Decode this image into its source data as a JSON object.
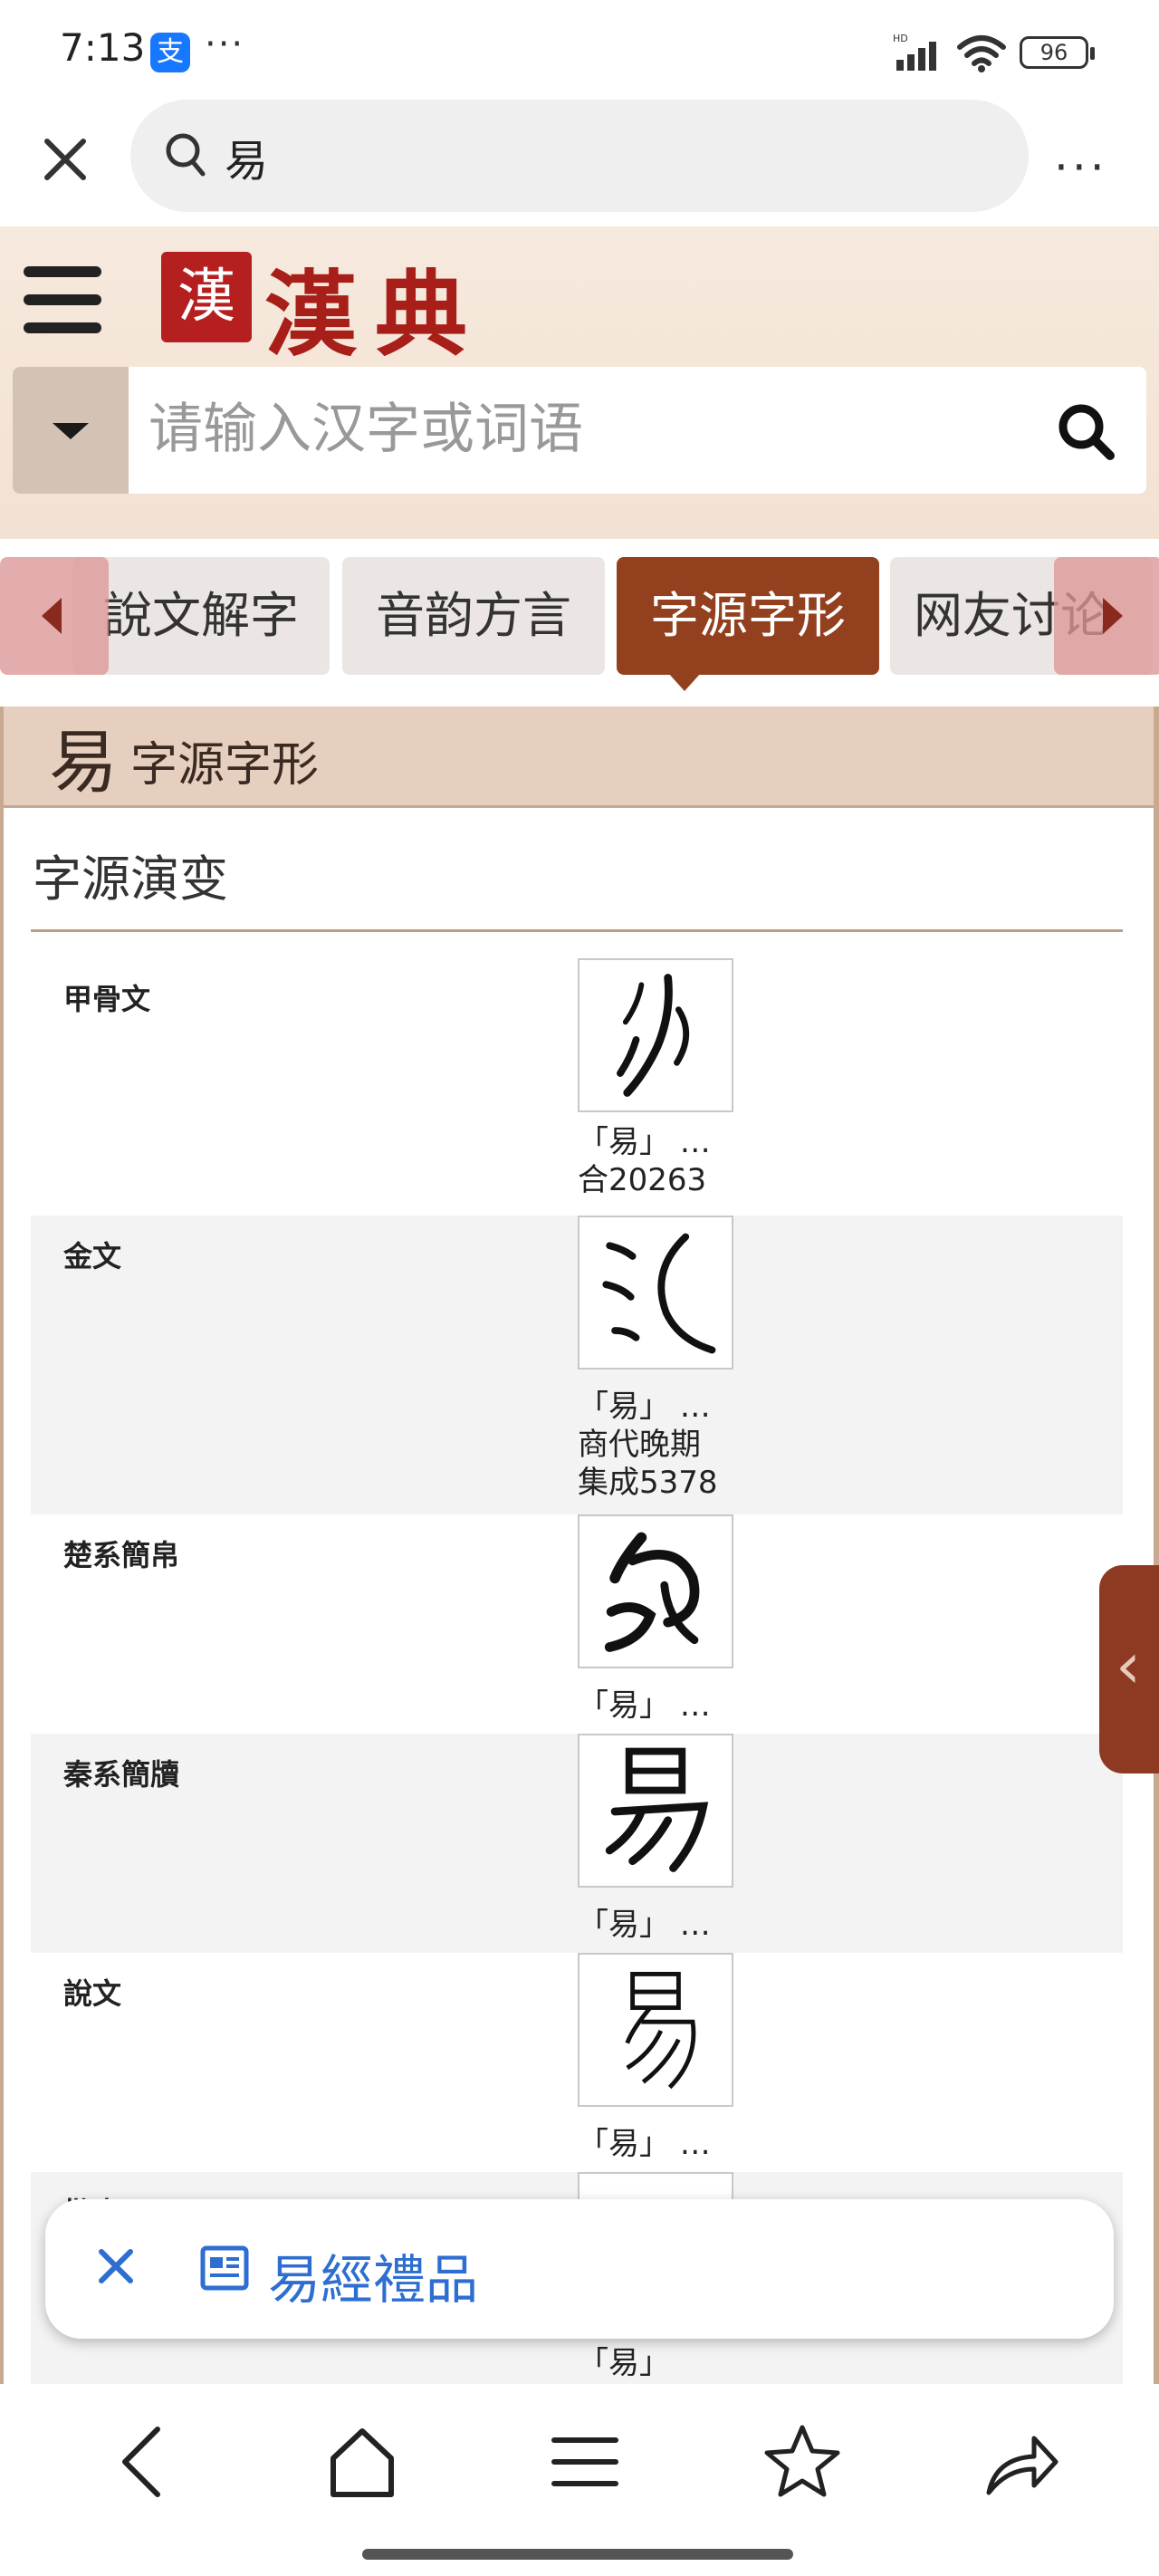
{
  "status_bar": {
    "time": "7:13",
    "app_badge": "支",
    "more": "···",
    "battery": "96",
    "network": "HD"
  },
  "browser": {
    "query": "易",
    "more_label": "⋮"
  },
  "site": {
    "logo_seal": "漢",
    "logo_text": "漢典",
    "search_placeholder": "请输入汉字或词语"
  },
  "tabs": [
    {
      "label": "說文解字",
      "active": false
    },
    {
      "label": "音韵方言",
      "active": false
    },
    {
      "label": "字源字形",
      "active": true
    },
    {
      "label": "网友讨论",
      "active": false
    }
  ],
  "section": {
    "char": "易",
    "title": "字源字形",
    "evolution_title": "字源演变"
  },
  "rows": [
    {
      "script": "甲骨文",
      "caption_lines": [
        "「易」 …",
        "合20263"
      ],
      "shaded": false
    },
    {
      "script": "金文",
      "caption_lines": [
        "「易」 …",
        "商代晚期",
        "集成5378"
      ],
      "shaded": true
    },
    {
      "script": "楚系簡帛",
      "caption_lines": [
        "「易」 …"
      ],
      "shaded": false
    },
    {
      "script": "秦系簡牘",
      "caption_lines": [
        "「易」 …"
      ],
      "shaded": true
    },
    {
      "script": "說文",
      "caption_lines": [
        "「易」 …"
      ],
      "shaded": false
    },
    {
      "script": "楷書",
      "caption_lines": [
        "「易」"
      ],
      "shaded": true
    }
  ],
  "ad_chip": {
    "label": "易經禮品"
  },
  "colors": {
    "accent": "#93401e",
    "logo_red": "#a81e18",
    "link_blue": "#2d6ed0"
  }
}
